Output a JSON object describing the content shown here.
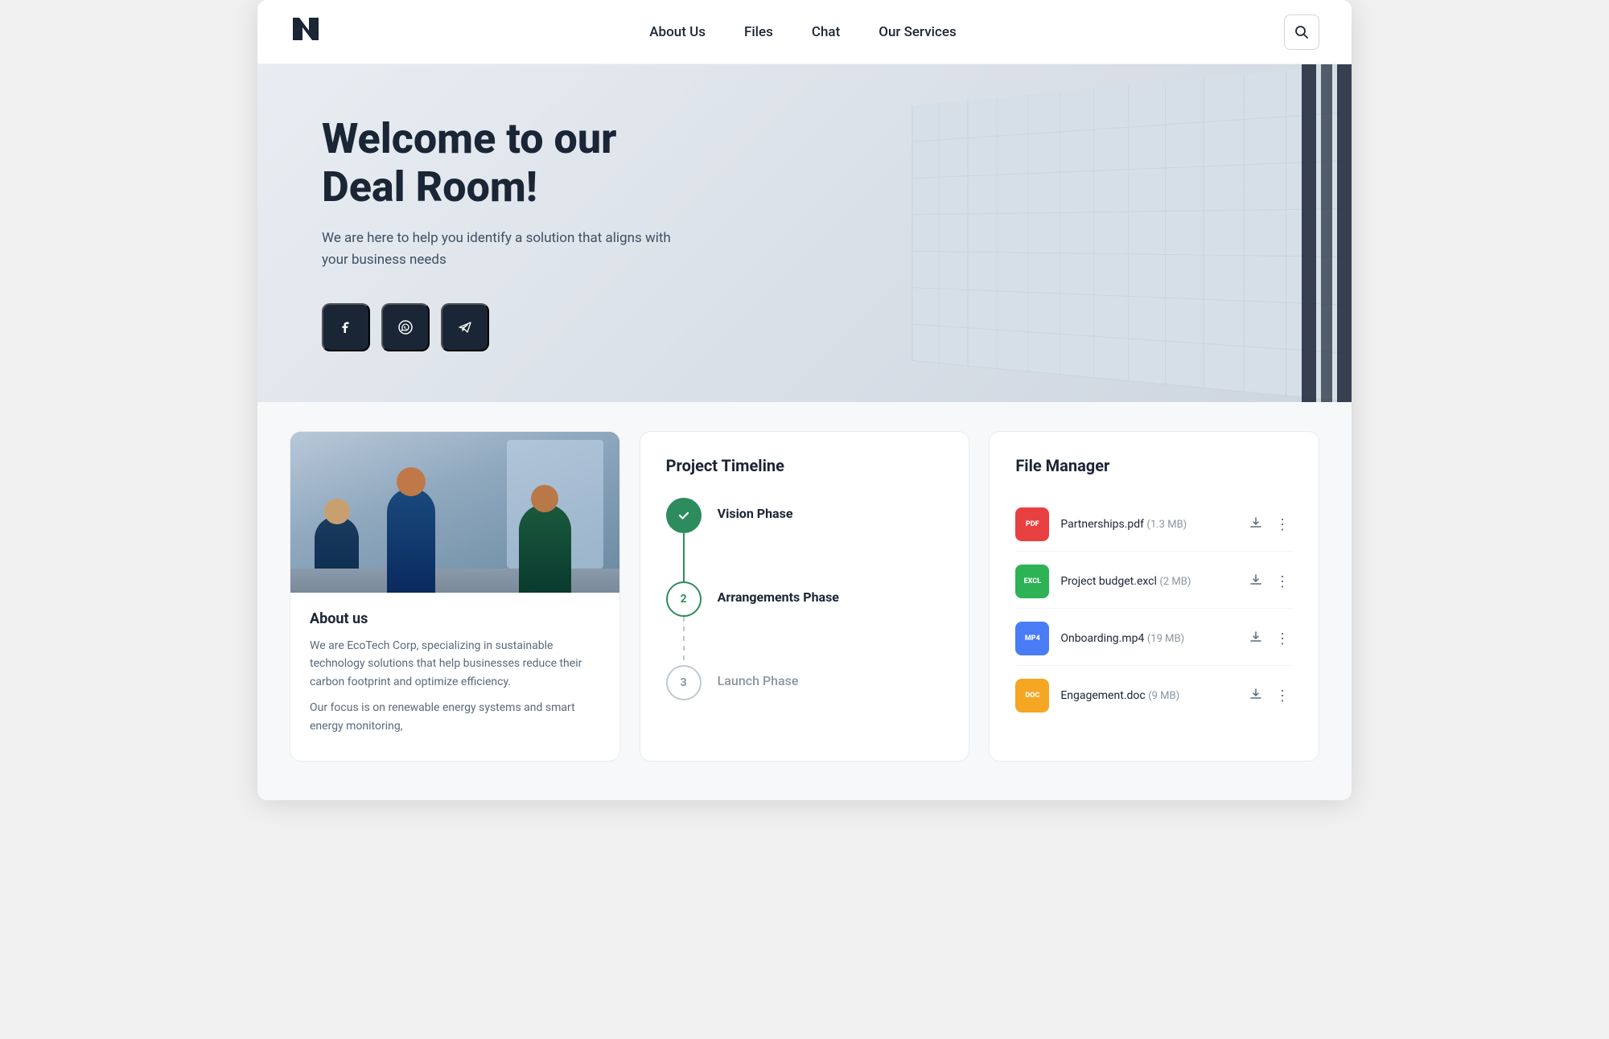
{
  "navbar": {
    "logo": "N←",
    "nav_items": [
      {
        "label": "About Us",
        "id": "about-us"
      },
      {
        "label": "Files",
        "id": "files"
      },
      {
        "label": "Chat",
        "id": "chat"
      },
      {
        "label": "Our Services",
        "id": "our-services"
      }
    ],
    "search_aria": "Search"
  },
  "hero": {
    "title": "Welcome to our Deal Room!",
    "subtitle": "We are here to help you identify a solution that aligns with your business needs",
    "socials": [
      {
        "id": "facebook",
        "icon": "f",
        "label": "Facebook"
      },
      {
        "id": "whatsapp",
        "icon": "📞",
        "label": "WhatsApp"
      },
      {
        "id": "telegram",
        "icon": "✈",
        "label": "Telegram"
      }
    ]
  },
  "about": {
    "section_title": "About us",
    "paragraph1": "We are EcoTech Corp, specializing in sustainable technology solutions that help businesses reduce their carbon footprint and optimize efficiency.",
    "paragraph2": "Our focus is on renewable energy systems and smart energy monitoring,"
  },
  "timeline": {
    "section_title": "Project Timeline",
    "items": [
      {
        "label": "Vision Phase",
        "state": "completed",
        "marker": "✓",
        "number": null
      },
      {
        "label": "Arrangements Phase",
        "state": "active",
        "marker": null,
        "number": "2"
      },
      {
        "label": "Launch Phase",
        "state": "inactive",
        "marker": null,
        "number": "3"
      }
    ]
  },
  "files": {
    "section_title": "File Manager",
    "items": [
      {
        "name": "Partnerships.pdf",
        "size": "(1.3 MB)",
        "badge": "PDF",
        "type": "pdf"
      },
      {
        "name": "Project budget.excl",
        "size": "(2 MB)",
        "badge": "EXCL",
        "type": "excl"
      },
      {
        "name": "Onboarding.mp4",
        "size": "(19 MB)",
        "badge": "MP4",
        "type": "mp4"
      },
      {
        "name": "Engagement.doc",
        "size": "(9 MB)",
        "badge": "DOC",
        "type": "doc"
      }
    ]
  }
}
